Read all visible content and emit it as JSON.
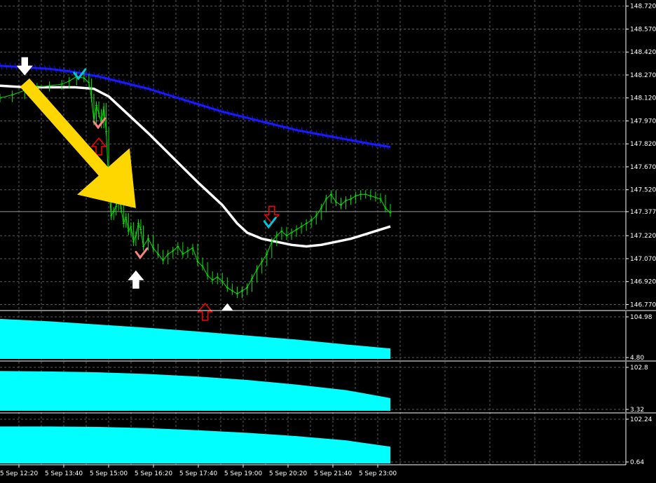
{
  "chart_data": [
    {
      "type": "line",
      "panel": "price",
      "title": "",
      "xlabel": "",
      "ylabel": "",
      "ylim": [
        146.74,
        148.76
      ],
      "grid": true,
      "y_ticks": [
        "148.720",
        "148.570",
        "148.420",
        "148.270",
        "148.120",
        "147.970",
        "147.820",
        "147.670",
        "147.520",
        "147.377",
        "147.220",
        "147.070",
        "146.920",
        "146.770"
      ],
      "current_price": "147.377",
      "x_ticks": [
        "5 Sep 12:20",
        "5 Sep 13:40",
        "5 Sep 15:00",
        "5 Sep 16:20",
        "5 Sep 17:40",
        "5 Sep 19:00",
        "5 Sep 20:20",
        "5 Sep 21:40",
        "5 Sep 23:00"
      ],
      "x_range": [
        0,
        165
      ],
      "series": [
        {
          "role": "price",
          "color": "#00e600",
          "values": [
            [
              0,
              148.12
            ],
            [
              5,
              148.14
            ],
            [
              10,
              148.17
            ],
            [
              15,
              148.19
            ],
            [
              20,
              148.2
            ],
            [
              25,
              148.21
            ],
            [
              28,
              148.23
            ],
            [
              31,
              148.26
            ],
            [
              34,
              148.25
            ],
            [
              36,
              148.22
            ],
            [
              37,
              148.12
            ],
            [
              38,
              147.97
            ],
            [
              39,
              148.07
            ],
            [
              40,
              148.02
            ],
            [
              41,
              147.95
            ],
            [
              42,
              148.06
            ],
            [
              43,
              147.9
            ],
            [
              44,
              147.55
            ],
            [
              45,
              147.35
            ],
            [
              46,
              147.38
            ],
            [
              47,
              147.41
            ],
            [
              48,
              147.48
            ],
            [
              49,
              147.4
            ],
            [
              50,
              147.3
            ],
            [
              51,
              147.34
            ],
            [
              52,
              147.25
            ],
            [
              53,
              147.28
            ],
            [
              54,
              147.18
            ],
            [
              55,
              147.22
            ],
            [
              56,
              147.3
            ],
            [
              57,
              147.26
            ],
            [
              58,
              147.15
            ],
            [
              60,
              147.2
            ],
            [
              62,
              147.14
            ],
            [
              64,
              147.1
            ],
            [
              66,
              147.06
            ],
            [
              68,
              147.1
            ],
            [
              70,
              147.12
            ],
            [
              72,
              147.15
            ],
            [
              74,
              147.1
            ],
            [
              76,
              147.12
            ],
            [
              78,
              147.14
            ],
            [
              80,
              147.05
            ],
            [
              82,
              147.02
            ],
            [
              84,
              146.96
            ],
            [
              86,
              146.93
            ],
            [
              88,
              146.95
            ],
            [
              90,
              146.92
            ],
            [
              92,
              146.88
            ],
            [
              94,
              146.86
            ],
            [
              96,
              146.84
            ],
            [
              98,
              146.86
            ],
            [
              100,
              146.88
            ],
            [
              102,
              146.94
            ],
            [
              104,
              147.0
            ],
            [
              106,
              147.05
            ],
            [
              108,
              147.1
            ],
            [
              110,
              147.18
            ],
            [
              112,
              147.22
            ],
            [
              114,
              147.25
            ],
            [
              116,
              147.22
            ],
            [
              118,
              147.24
            ],
            [
              120,
              147.26
            ],
            [
              122,
              147.28
            ],
            [
              124,
              147.3
            ],
            [
              126,
              147.32
            ],
            [
              128,
              147.35
            ],
            [
              130,
              147.4
            ],
            [
              132,
              147.46
            ],
            [
              134,
              147.49
            ],
            [
              136,
              147.44
            ],
            [
              138,
              147.42
            ],
            [
              140,
              147.45
            ],
            [
              142,
              147.46
            ],
            [
              144,
              147.48
            ],
            [
              146,
              147.49
            ],
            [
              148,
              147.49
            ],
            [
              150,
              147.48
            ],
            [
              152,
              147.47
            ],
            [
              154,
              147.46
            ],
            [
              156,
              147.4
            ],
            [
              158,
              147.37
            ]
          ]
        },
        {
          "role": "moving-average-slow",
          "color": "#1a1aff",
          "values": [
            [
              0,
              148.33
            ],
            [
              10,
              148.32
            ],
            [
              20,
              148.31
            ],
            [
              30,
              148.29
            ],
            [
              40,
              148.26
            ],
            [
              50,
              148.22
            ],
            [
              60,
              148.18
            ],
            [
              70,
              148.13
            ],
            [
              80,
              148.08
            ],
            [
              90,
              148.03
            ],
            [
              100,
              147.99
            ],
            [
              110,
              147.95
            ],
            [
              120,
              147.91
            ],
            [
              130,
              147.88
            ],
            [
              140,
              147.85
            ],
            [
              150,
              147.82
            ],
            [
              158,
              147.8
            ]
          ]
        },
        {
          "role": "moving-average-fast",
          "color": "#ffffff",
          "values": [
            [
              0,
              148.2
            ],
            [
              10,
              148.19
            ],
            [
              20,
              148.19
            ],
            [
              30,
              148.19
            ],
            [
              38,
              148.18
            ],
            [
              44,
              148.13
            ],
            [
              50,
              148.04
            ],
            [
              60,
              147.89
            ],
            [
              70,
              147.73
            ],
            [
              80,
              147.57
            ],
            [
              90,
              147.42
            ],
            [
              96,
              147.3
            ],
            [
              100,
              147.24
            ],
            [
              106,
              147.2
            ],
            [
              112,
              147.18
            ],
            [
              118,
              147.16
            ],
            [
              124,
              147.15
            ],
            [
              130,
              147.16
            ],
            [
              136,
              147.18
            ],
            [
              142,
              147.2
            ],
            [
              148,
              147.23
            ],
            [
              154,
              147.26
            ],
            [
              158,
              147.28
            ]
          ]
        }
      ],
      "annotations": [
        {
          "kind": "arrow-down",
          "color": "#ffffff",
          "x": 10,
          "y": 148.3
        },
        {
          "kind": "arrow-up",
          "color": "#ff0000",
          "x": 40,
          "y": 147.83
        },
        {
          "kind": "arrow-up",
          "color": "#ffffff",
          "x": 55,
          "y": 146.96
        },
        {
          "kind": "arrow-up",
          "color": "#ff0000",
          "x": 83,
          "y": 146.75
        },
        {
          "kind": "arrow-down",
          "color": "#ff0000",
          "x": 110,
          "y": 147.33
        },
        {
          "kind": "triangle-up",
          "color": "#ffffff",
          "x": 92,
          "y": 146.76
        },
        {
          "kind": "check",
          "color": "#00c8dc",
          "x": 32,
          "y": 148.27
        },
        {
          "kind": "check",
          "color": "#ff8080",
          "x": 40,
          "y": 147.95
        },
        {
          "kind": "check",
          "color": "#ff8080",
          "x": 57,
          "y": 147.1
        },
        {
          "kind": "check",
          "color": "#00c8dc",
          "x": 109,
          "y": 147.3
        },
        {
          "kind": "big-arrow",
          "color": "#ffd700",
          "x_from": 10,
          "y_from": 148.22,
          "x_to": 55,
          "y_to": 147.4
        }
      ]
    },
    {
      "type": "area",
      "panel": "indicator-1",
      "color": "#00ffff",
      "y_ticks": [
        "104.98",
        "4.80"
      ],
      "ylim": [
        4.8,
        104.98
      ],
      "x": [
        0,
        20,
        40,
        60,
        80,
        100,
        120,
        140,
        158
      ],
      "values": [
        100,
        94,
        86,
        78,
        69,
        59,
        49,
        37,
        27
      ]
    },
    {
      "type": "area",
      "panel": "indicator-2",
      "color": "#00ffff",
      "y_ticks": [
        "102.8",
        "3.32"
      ],
      "ylim": [
        3.32,
        102.8
      ],
      "x": [
        0,
        20,
        40,
        60,
        80,
        100,
        120,
        140,
        158
      ],
      "values": [
        94,
        93,
        91,
        87,
        81,
        73,
        62,
        49,
        30
      ]
    },
    {
      "type": "area",
      "panel": "indicator-3",
      "color": "#00ffff",
      "y_ticks": [
        "102.24",
        "0.64"
      ],
      "ylim": [
        0.64,
        102.24
      ],
      "x": [
        0,
        20,
        40,
        60,
        80,
        100,
        120,
        140,
        158
      ],
      "values": [
        85,
        85,
        84,
        81,
        76,
        70,
        62,
        52,
        37
      ]
    }
  ]
}
